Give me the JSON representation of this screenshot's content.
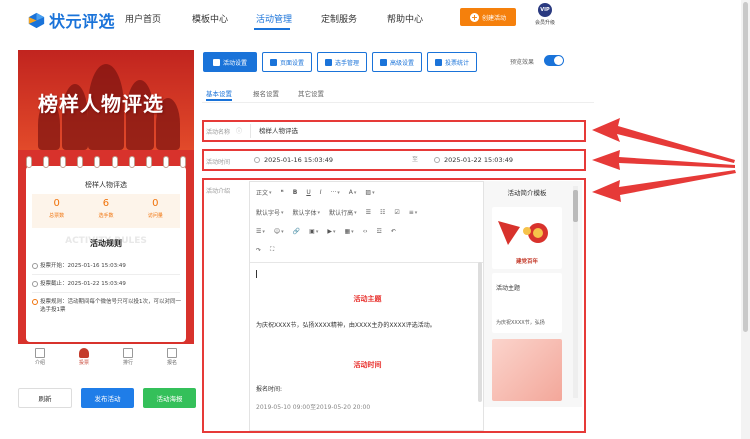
{
  "brand": {
    "name": "状元评选",
    "color": "#1a73d9"
  },
  "nav": {
    "items": [
      "用户首页",
      "模板中心",
      "活动管理",
      "定制服务",
      "帮助中心"
    ],
    "active_index": 2,
    "create_label": "创建活动",
    "vip_badge": "VIP",
    "vip_label": "会员升级"
  },
  "preview": {
    "banner_title": "榜样人物评选",
    "card_title": "榜样人物评选",
    "stats": [
      {
        "value": "0",
        "label": "总票数"
      },
      {
        "value": "6",
        "label": "选手数"
      },
      {
        "value": "0",
        "label": "访问量"
      }
    ],
    "rules_ghost": "ACTIVITY RULES",
    "rules_title": "活动规则",
    "rules": [
      {
        "text": "投票开始：2025-01-16 15:03:49"
      },
      {
        "text": "投票截止：2025-01-22 15:03:49"
      },
      {
        "text": "投票规则：活动期间每个微信号只可以投1次，可以对同一选手投1票"
      }
    ],
    "bottom_tabs": [
      "介绍",
      "投票",
      "排行",
      "报名"
    ],
    "bottom_tabs_active": 1
  },
  "actions": {
    "refresh": "刷新",
    "publish": "发布活动",
    "poster": "活动海报"
  },
  "toolbar_tabs": [
    "活动设置",
    "页面设置",
    "选手管理",
    "高级设置",
    "投票统计"
  ],
  "preview_toggle": {
    "label": "预览效果",
    "on": true
  },
  "subtabs": [
    "基本设置",
    "报名设置",
    "其它设置"
  ],
  "form": {
    "name_label": "活动名称",
    "name_value": "榜样人物评选",
    "time_label": "活动时间",
    "start_time": "2025-01-16 15:03:49",
    "separator": "至",
    "end_time": "2025-01-22 15:03:49",
    "intro_label": "活动介绍"
  },
  "editor": {
    "row1": [
      "正文",
      "❝",
      "B",
      "U",
      "I",
      "···",
      "A",
      "▨"
    ],
    "row2": [
      "默认字号",
      "默认字体",
      "默认行高",
      "☰",
      "☷",
      "☑",
      "≡"
    ],
    "row3": [
      "☰",
      "☺",
      "🔗",
      "▣",
      "▶",
      "▦",
      "‹›",
      "☲",
      "↶"
    ],
    "row4": [
      "↷",
      "⛶"
    ],
    "heading1": "活动主题",
    "paragraph1": "为庆祝XXXX节，弘扬XXXX精神，由XXXX主办的XXXX评选活动。",
    "heading2": "活动时间",
    "paragraph2": "报名时间:",
    "paragraph3": "2019-05-10 09:00至2019-05-20 20:00"
  },
  "templates": {
    "title": "活动简介模板",
    "card1_text": "建党百年",
    "card2_title": "活动主题",
    "card2_text": "为庆祝XXXX节，弘扬"
  },
  "colors": {
    "highlight": "#e63a38",
    "accent_orange": "#f5800c",
    "banner_red": "#d8322c",
    "success": "#34c05a"
  }
}
